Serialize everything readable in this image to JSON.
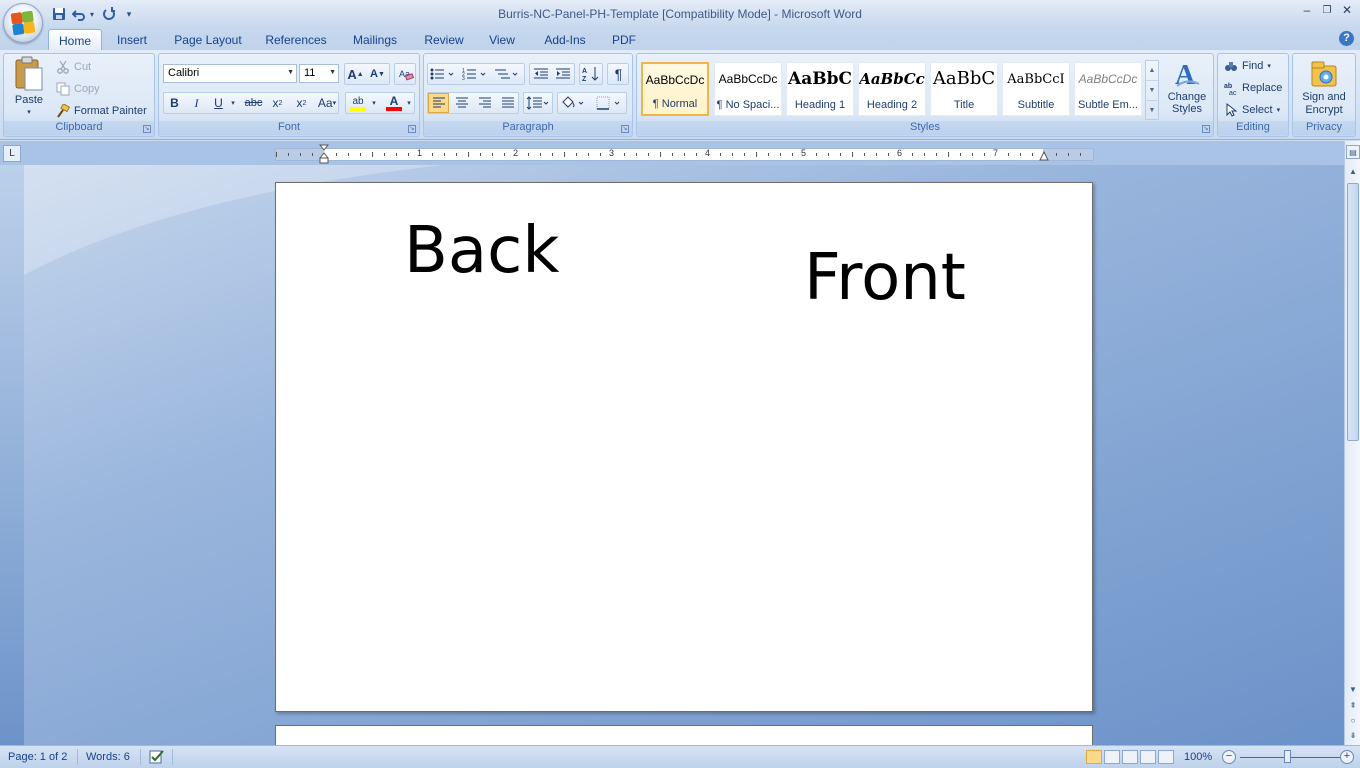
{
  "window": {
    "title": "Burris-NC-Panel-PH-Template [Compatibility Mode] - Microsoft Word",
    "controls": {
      "minimize": "–",
      "restore": "❐",
      "close": "✕"
    }
  },
  "qat": {
    "save": "save-icon",
    "undo": "undo-icon",
    "redo": "redo-icon",
    "customize": "▾"
  },
  "tabs": [
    {
      "label": "Home",
      "active": true
    },
    {
      "label": "Insert"
    },
    {
      "label": "Page Layout"
    },
    {
      "label": "References"
    },
    {
      "label": "Mailings"
    },
    {
      "label": "Review"
    },
    {
      "label": "View"
    },
    {
      "label": "Add-Ins"
    },
    {
      "label": "PDF"
    }
  ],
  "help": "?",
  "clipboard": {
    "label": "Clipboard",
    "paste": "Paste",
    "cut": "Cut",
    "copy": "Copy",
    "format_painter": "Format Painter"
  },
  "font": {
    "label": "Font",
    "name": "Calibri",
    "size": "11",
    "grow": "A",
    "shrink": "A",
    "bold": "B",
    "italic": "I",
    "underline": "U",
    "strike": "abc",
    "subscript": "x",
    "superscript": "x",
    "change_case": "Aa",
    "highlight": "ab",
    "font_color": "A"
  },
  "paragraph": {
    "label": "Paragraph",
    "pilcrow": "¶"
  },
  "styles": {
    "label": "Styles",
    "items": [
      {
        "sample": "AaBbCcDc",
        "name": "¶ Normal",
        "selected": true
      },
      {
        "sample": "AaBbCcDc",
        "name": "¶ No Spaci..."
      },
      {
        "sample": "AaBbC",
        "name": "Heading 1"
      },
      {
        "sample": "AaBbCc",
        "name": "Heading 2"
      },
      {
        "sample": "AaBbC",
        "name": "Title"
      },
      {
        "sample": "AaBbCcI",
        "name": "Subtitle"
      },
      {
        "sample": "AaBbCcDc",
        "name": "Subtle Em..."
      }
    ],
    "change_styles": "Change Styles"
  },
  "editing": {
    "label": "Editing",
    "find": "Find",
    "replace": "Replace",
    "select": "Select"
  },
  "privacy": {
    "label": "Privacy",
    "sign_encrypt": "Sign and Encrypt"
  },
  "ruler": {
    "numbers": [
      "1",
      "2",
      "3",
      "4",
      "5",
      "6",
      "7"
    ],
    "tab_selector": "L"
  },
  "document": {
    "back_text": "Back",
    "front_text": "Front"
  },
  "status": {
    "page": "Page: 1 of 2",
    "words": "Words: 6",
    "zoom": "100%"
  }
}
